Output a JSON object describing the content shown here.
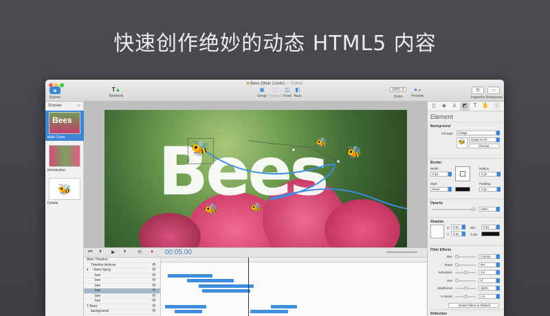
{
  "headline": "快速创作绝妙的动态 HTML5 内容",
  "window": {
    "title": "Bees (Main Cover)",
    "edited": "— Edited",
    "traffic_lights": [
      "#fc5f57",
      "#fdbc2e",
      "#33c748"
    ]
  },
  "toolbar": {
    "scenes": "Scenes",
    "elements": "Elements",
    "group": "Group",
    "ungroup": "Ungroup",
    "front": "Front",
    "back": "Back",
    "zoom_value": "100%",
    "zoom": "Zoom",
    "preview": "Preview",
    "inspector": "Inspector",
    "resources": "Resources"
  },
  "scenes_panel": {
    "header": "Scenes",
    "add": "+",
    "items": [
      {
        "label": "Main Cover",
        "selected": true
      },
      {
        "label": "Introduction",
        "selected": false
      },
      {
        "label": "Details",
        "selected": false
      }
    ]
  },
  "canvas": {
    "word": "Bees"
  },
  "inspector": {
    "title": "Element",
    "background": {
      "title": "Background",
      "fill_style_label": "Fill Style",
      "fill_style": "Image",
      "scale": "Scale To Fit",
      "choose": "Choose..."
    },
    "border": {
      "title": "Border",
      "width_label": "Width",
      "width": "0 px",
      "radius_label": "Radius",
      "radius": "0 px",
      "style_label": "Style",
      "style": "None",
      "padding_label": "Padding",
      "padding": "0 px"
    },
    "opacity": {
      "title": "Opacity",
      "value": "100%",
      "level": 1.0
    },
    "shadow": {
      "title": "Shadow",
      "x_label": "X",
      "x": "0 px",
      "y_label": "Y",
      "y": "0 px",
      "blur_label": "Blur",
      "blur": "0 px",
      "color_label": "Color"
    },
    "filter_effects": {
      "title": "Filter Effects",
      "rows": [
        {
          "label": "Blur",
          "value": "0.00 px",
          "level": 0.0
        },
        {
          "label": "Sepia",
          "value": "0%",
          "level": 0.0
        },
        {
          "label": "Saturation",
          "value": "1.0",
          "level": 0.5
        },
        {
          "label": "Hue",
          "value": "0°",
          "level": 0.0
        },
        {
          "label": "Brightness",
          "value": "100%",
          "level": 0.5
        },
        {
          "label": "Contrast",
          "value": "1.0",
          "level": 0.5
        }
      ],
      "reset": "Reset Filters to Default"
    },
    "reflection": {
      "title": "Reflection"
    }
  },
  "timeline": {
    "time": "00:05.00",
    "rows": [
      {
        "label": "Main Timeline",
        "indent": 0,
        "selected": false
      },
      {
        "label": "Timeline Actions",
        "indent": 1,
        "selected": false
      },
      {
        "label": "▾ 🗀 Bees flying",
        "indent": 0,
        "selected": false
      },
      {
        "label": "bee",
        "indent": 2,
        "selected": false
      },
      {
        "label": "bee",
        "indent": 2,
        "selected": false
      },
      {
        "label": "bee",
        "indent": 2,
        "selected": false
      },
      {
        "label": "bee",
        "indent": 2,
        "selected": true
      },
      {
        "label": "bee",
        "indent": 2,
        "selected": false
      },
      {
        "label": "bee",
        "indent": 2,
        "selected": false
      },
      {
        "label": "T  Bees",
        "indent": 0,
        "selected": false
      },
      {
        "label": "background",
        "indent": 1,
        "selected": false
      }
    ],
    "accent": "#3d8ede"
  }
}
